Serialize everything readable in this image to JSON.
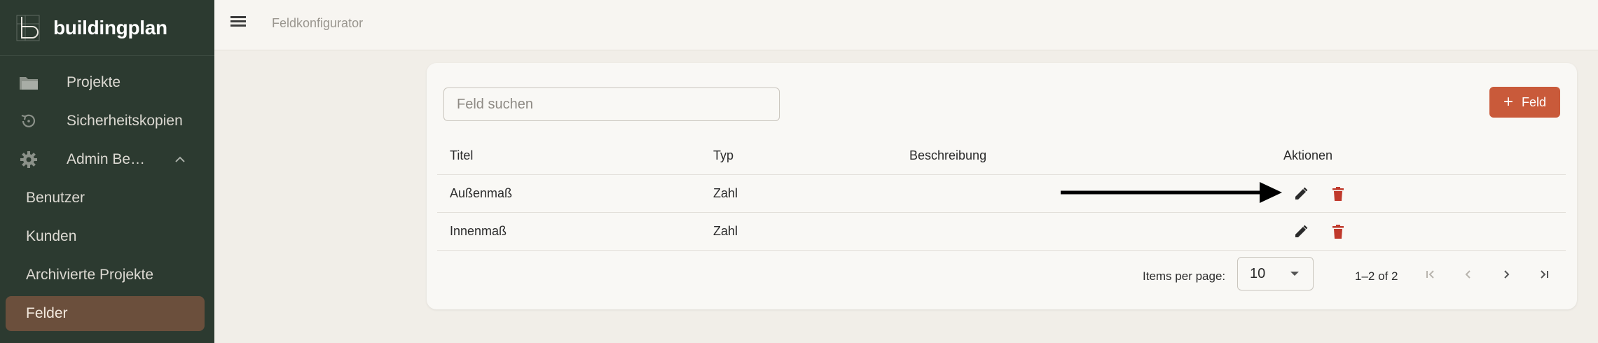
{
  "brand": {
    "name": "buildingplan"
  },
  "sidebar": {
    "items": [
      {
        "label": "Projekte",
        "icon": "folder-icon"
      },
      {
        "label": "Sicherheitskopien",
        "icon": "history-icon"
      },
      {
        "label": "Admin Be…",
        "icon": "gear-icon"
      }
    ],
    "subitems": [
      {
        "label": "Benutzer"
      },
      {
        "label": "Kunden"
      },
      {
        "label": "Archivierte Projekte"
      },
      {
        "label": "Felder",
        "active": true
      }
    ]
  },
  "topbar": {
    "title": "Feldkonfigurator"
  },
  "search": {
    "placeholder": "Feld suchen"
  },
  "add_button": {
    "label": "Feld"
  },
  "table": {
    "headers": {
      "title": "Titel",
      "type": "Typ",
      "description": "Beschreibung",
      "actions": "Aktionen"
    },
    "rows": [
      {
        "title": "Außenmaß",
        "type": "Zahl",
        "description": ""
      },
      {
        "title": "Innenmaß",
        "type": "Zahl",
        "description": ""
      }
    ]
  },
  "pagination": {
    "items_per_page_label": "Items per page:",
    "items_per_page": "10",
    "range": "1–2 of 2"
  },
  "colors": {
    "sidebar_bg": "#2c3a30",
    "active_item_bg": "#6b4f3c",
    "accent": "#c95a3a",
    "delete": "#c0392b"
  }
}
